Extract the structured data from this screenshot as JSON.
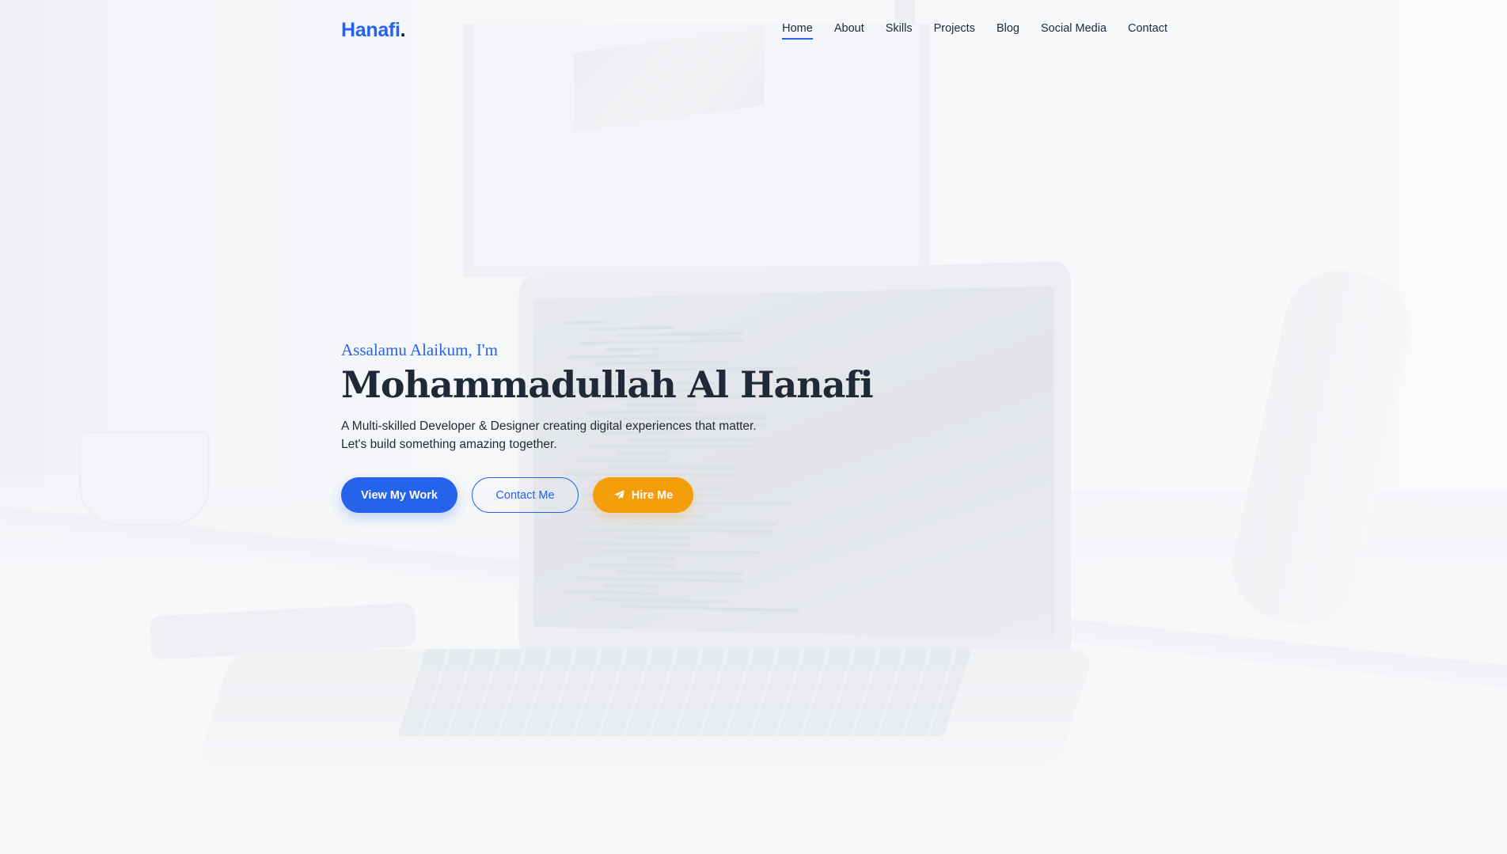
{
  "brand": {
    "name": "Hanafi",
    "dot": "."
  },
  "nav": {
    "items": [
      {
        "label": "Home",
        "active": true
      },
      {
        "label": "About"
      },
      {
        "label": "Skills"
      },
      {
        "label": "Projects"
      },
      {
        "label": "Blog"
      },
      {
        "label": "Social Media"
      },
      {
        "label": "Contact"
      }
    ]
  },
  "hero": {
    "greeting": "Assalamu Alaikum, I'm",
    "name": "Mohammadullah Al Hanafi",
    "description": "A Multi-skilled Developer & Designer creating digital experiences that matter. Let's build something amazing together.",
    "buttons": {
      "view_work": "View My Work",
      "contact": "Contact Me",
      "hire": "Hire Me",
      "hire_icon": "paper-plane-icon"
    }
  },
  "colors": {
    "accent": "#2563eb",
    "hire": "#f59e0b",
    "text": "#1f2937"
  }
}
